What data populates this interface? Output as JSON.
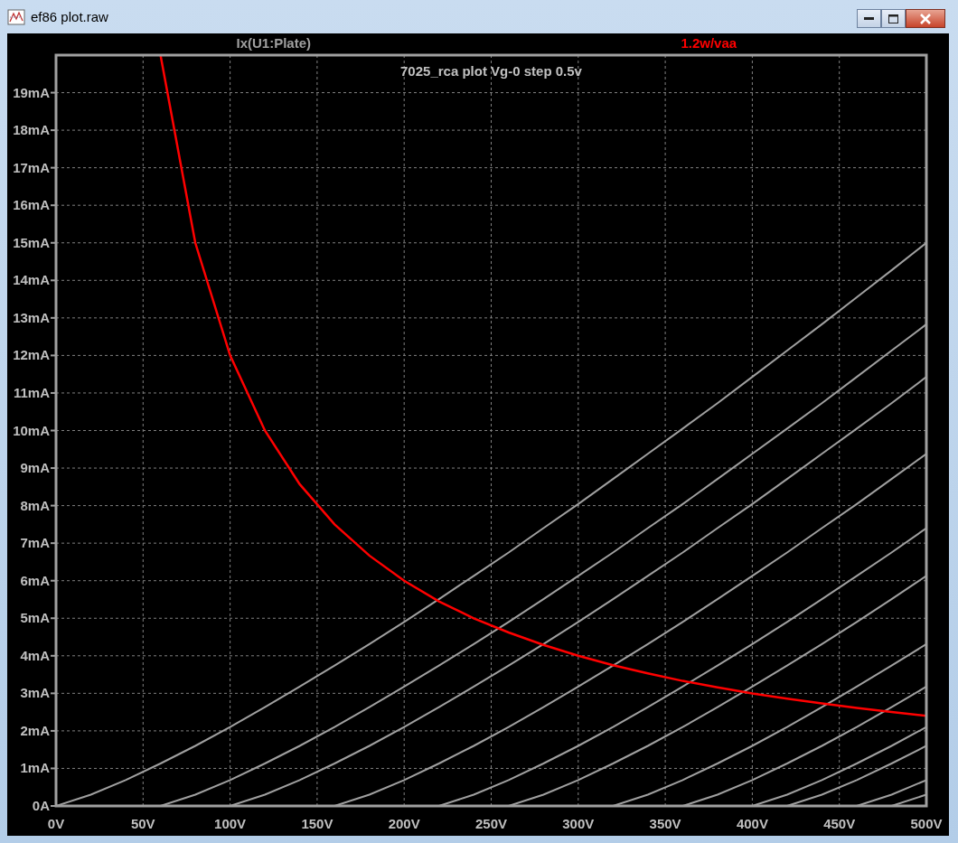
{
  "window": {
    "title": "ef86 plot.raw"
  },
  "plot": {
    "chart_data": {
      "type": "line",
      "title": "7025_rca plot Vg-0 step 0.5v",
      "grid": true,
      "x": [
        0,
        20,
        40,
        60,
        80,
        100,
        120,
        140,
        160,
        180,
        200,
        220,
        240,
        260,
        280,
        300,
        320,
        340,
        360,
        380,
        400,
        420,
        440,
        460,
        480,
        500
      ],
      "xlim": [
        0,
        500
      ],
      "ylim": [
        0,
        20
      ],
      "xticks": [
        {
          "value": 0,
          "label": "0V"
        },
        {
          "value": 50,
          "label": "50V"
        },
        {
          "value": 100,
          "label": "100V"
        },
        {
          "value": 150,
          "label": "150V"
        },
        {
          "value": 200,
          "label": "200V"
        },
        {
          "value": 250,
          "label": "250V"
        },
        {
          "value": 300,
          "label": "300V"
        },
        {
          "value": 350,
          "label": "350V"
        },
        {
          "value": 400,
          "label": "400V"
        },
        {
          "value": 450,
          "label": "450V"
        },
        {
          "value": 500,
          "label": "500V"
        }
      ],
      "yticks": [
        {
          "value": 0,
          "label": "0A"
        },
        {
          "value": 1,
          "label": "1mA"
        },
        {
          "value": 2,
          "label": "2mA"
        },
        {
          "value": 3,
          "label": "3mA"
        },
        {
          "value": 4,
          "label": "4mA"
        },
        {
          "value": 5,
          "label": "5mA"
        },
        {
          "value": 6,
          "label": "6mA"
        },
        {
          "value": 7,
          "label": "7mA"
        },
        {
          "value": 8,
          "label": "8mA"
        },
        {
          "value": 9,
          "label": "9mA"
        },
        {
          "value": 10,
          "label": "10mA"
        },
        {
          "value": 11,
          "label": "11mA"
        },
        {
          "value": 12,
          "label": "12mA"
        },
        {
          "value": 13,
          "label": "13mA"
        },
        {
          "value": 14,
          "label": "14mA"
        },
        {
          "value": 15,
          "label": "15mA"
        },
        {
          "value": 16,
          "label": "16mA"
        },
        {
          "value": 17,
          "label": "17mA"
        },
        {
          "value": 18,
          "label": "18mA"
        },
        {
          "value": 19,
          "label": "19mA"
        }
      ],
      "series": [
        {
          "name": "Ix(U1:Plate)",
          "color": "#a0a0a0",
          "values": [
            0,
            0.3,
            0.69,
            1.13,
            1.6,
            2.1,
            2.63,
            3.18,
            3.74,
            4.31,
            4.9,
            5.51,
            6.13,
            6.75,
            7.4,
            8.04,
            8.71,
            9.38,
            10.05,
            10.73,
            11.43,
            12.13,
            12.83,
            13.55,
            14.27,
            15
          ]
        },
        {
          "color": "#a0a0a0",
          "values": [
            null,
            null,
            null,
            0,
            0.3,
            0.69,
            1.13,
            1.6,
            2.1,
            2.63,
            3.18,
            3.74,
            4.31,
            4.9,
            5.51,
            6.13,
            6.75,
            7.4,
            8.04,
            8.71,
            9.38,
            10.05,
            10.73,
            11.43,
            12.13,
            12.83
          ]
        },
        {
          "color": "#a0a0a0",
          "values": [
            null,
            null,
            null,
            null,
            null,
            0,
            0.3,
            0.69,
            1.13,
            1.6,
            2.1,
            2.63,
            3.18,
            3.74,
            4.31,
            4.9,
            5.51,
            6.13,
            6.75,
            7.4,
            8.04,
            8.71,
            9.38,
            10.05,
            10.73,
            11.43
          ]
        },
        {
          "color": "#a0a0a0",
          "values": [
            null,
            null,
            null,
            null,
            null,
            null,
            null,
            null,
            0,
            0.3,
            0.69,
            1.13,
            1.6,
            2.1,
            2.63,
            3.18,
            3.74,
            4.31,
            4.9,
            5.51,
            6.13,
            6.75,
            7.4,
            8.04,
            8.71,
            9.38
          ]
        },
        {
          "color": "#a0a0a0",
          "values": [
            null,
            null,
            null,
            null,
            null,
            null,
            null,
            null,
            null,
            null,
            null,
            0,
            0.3,
            0.69,
            1.13,
            1.6,
            2.1,
            2.63,
            3.18,
            3.74,
            4.31,
            4.9,
            5.51,
            6.13,
            6.75,
            7.4
          ]
        },
        {
          "color": "#a0a0a0",
          "values": [
            null,
            null,
            null,
            null,
            null,
            null,
            null,
            null,
            null,
            null,
            null,
            null,
            null,
            0,
            0.3,
            0.69,
            1.13,
            1.6,
            2.1,
            2.63,
            3.18,
            3.74,
            4.31,
            4.9,
            5.51,
            6.13
          ]
        },
        {
          "color": "#a0a0a0",
          "values": [
            null,
            null,
            null,
            null,
            null,
            null,
            null,
            null,
            null,
            null,
            null,
            null,
            null,
            null,
            null,
            null,
            0,
            0.3,
            0.69,
            1.13,
            1.6,
            2.1,
            2.63,
            3.18,
            3.74,
            4.31
          ]
        },
        {
          "color": "#a0a0a0",
          "values": [
            null,
            null,
            null,
            null,
            null,
            null,
            null,
            null,
            null,
            null,
            null,
            null,
            null,
            null,
            null,
            null,
            null,
            null,
            0,
            0.3,
            0.69,
            1.13,
            1.6,
            2.1,
            2.63,
            3.18
          ]
        },
        {
          "color": "#a0a0a0",
          "values": [
            null,
            null,
            null,
            null,
            null,
            null,
            null,
            null,
            null,
            null,
            null,
            null,
            null,
            null,
            null,
            null,
            null,
            null,
            null,
            null,
            0,
            0.3,
            0.69,
            1.13,
            1.6,
            2.1
          ]
        },
        {
          "color": "#a0a0a0",
          "values": [
            null,
            null,
            null,
            null,
            null,
            null,
            null,
            null,
            null,
            null,
            null,
            null,
            null,
            null,
            null,
            null,
            null,
            null,
            null,
            null,
            null,
            0,
            0.3,
            0.69,
            1.13,
            1.6
          ]
        },
        {
          "color": "#a0a0a0",
          "values": [
            null,
            null,
            null,
            null,
            null,
            null,
            null,
            null,
            null,
            null,
            null,
            null,
            null,
            null,
            null,
            null,
            null,
            null,
            null,
            null,
            null,
            null,
            null,
            0,
            0.3,
            0.69
          ]
        },
        {
          "color": "#a0a0a0",
          "values": [
            null,
            null,
            null,
            null,
            null,
            null,
            null,
            null,
            null,
            null,
            null,
            null,
            null,
            null,
            null,
            null,
            null,
            null,
            null,
            null,
            null,
            null,
            null,
            null,
            0,
            0.3
          ]
        },
        {
          "name": "1.2w/vaa",
          "color": "#ff0000",
          "values": [
            null,
            null,
            null,
            20,
            15,
            12,
            10,
            8.57,
            7.5,
            6.67,
            6,
            5.45,
            5,
            4.62,
            4.29,
            4,
            3.75,
            3.53,
            3.33,
            3.16,
            3,
            2.86,
            2.73,
            2.61,
            2.5,
            2.4
          ]
        }
      ]
    }
  }
}
